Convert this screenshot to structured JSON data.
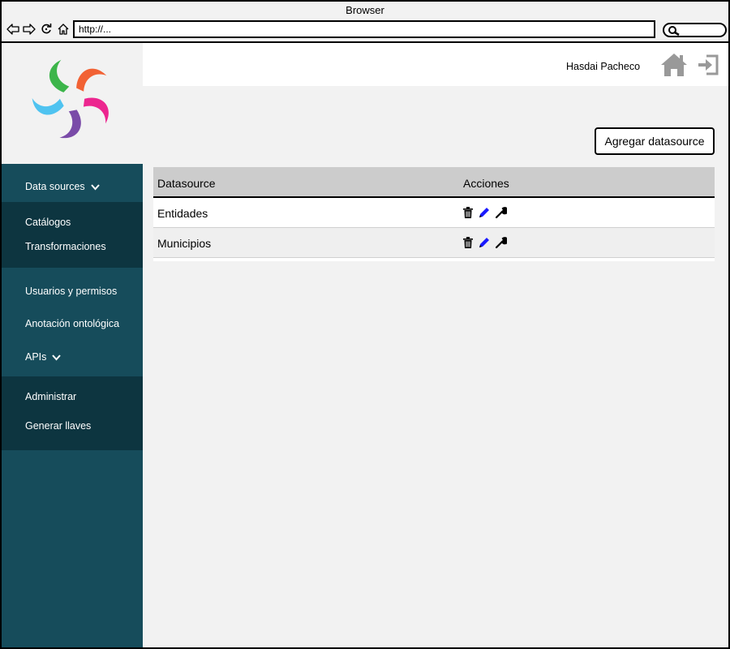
{
  "browser": {
    "title": "Browser",
    "url": "http://..."
  },
  "user": {
    "name": "Hasdai Pacheco"
  },
  "sidebar": {
    "data_sources": "Data sources",
    "catalogos": "Catálogos",
    "transformaciones": "Transformaciones",
    "usuarios": "Usuarios y permisos",
    "anotacion": "Anotación ontológica",
    "apis": "APIs",
    "administrar": "Administrar",
    "generar_llaves": "Generar llaves"
  },
  "main": {
    "add_button": "Agregar datasource",
    "table": {
      "headers": [
        "Datasource",
        "Acciones"
      ],
      "rows": [
        {
          "name": "Entidades"
        },
        {
          "name": "Municipios"
        }
      ]
    }
  },
  "icons": {
    "back": "back-arrow-icon",
    "forward": "forward-arrow-icon",
    "reload": "reload-icon",
    "home": "home-icon",
    "search": "search-icon",
    "logout": "logout-icon",
    "delete": "trash-icon",
    "edit": "pencil-icon",
    "configure": "wrench-icon"
  },
  "colors": {
    "sidebar": "#164c5b",
    "sidebar_submenu": "#0d3540",
    "edit_icon": "#1a1aff",
    "table_header": "#cccccc"
  }
}
